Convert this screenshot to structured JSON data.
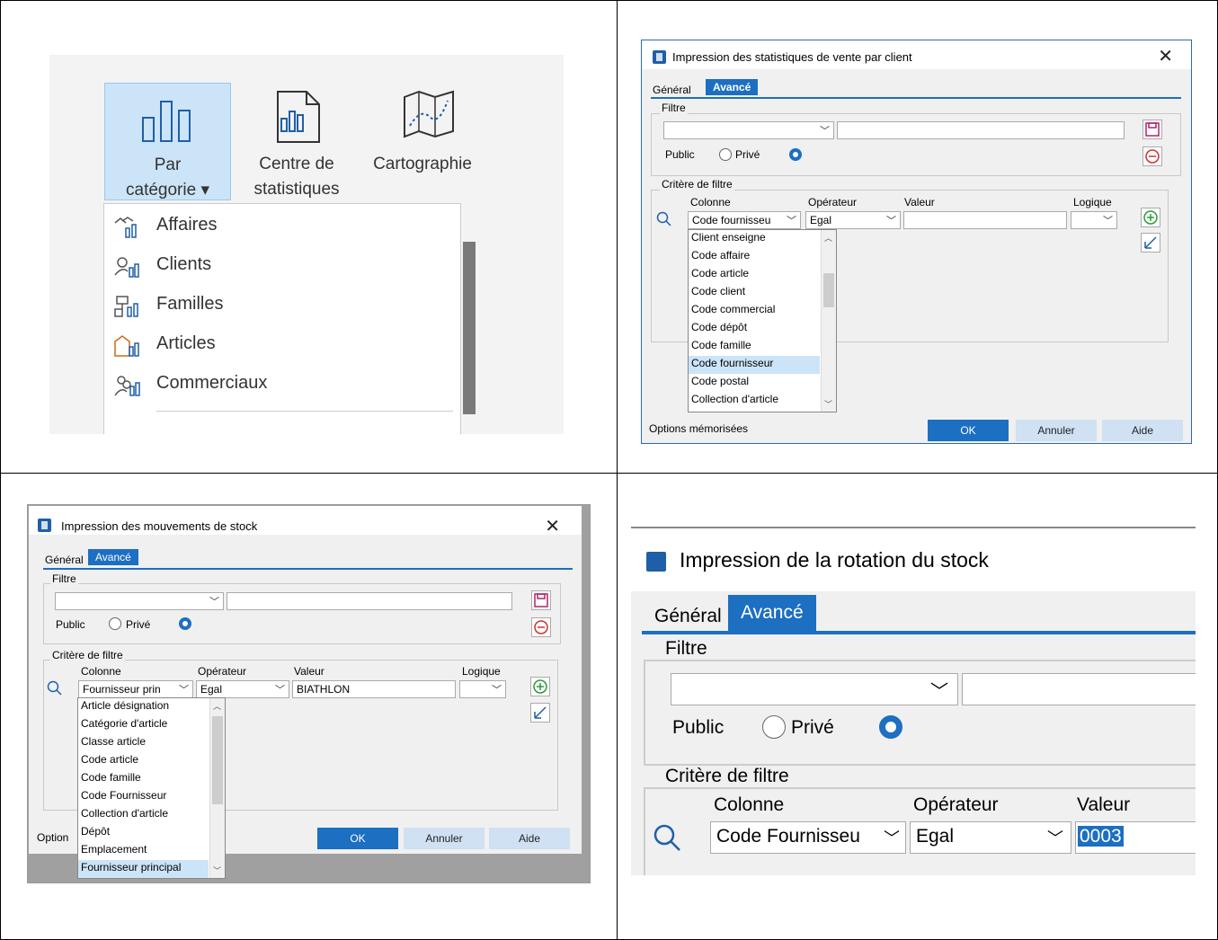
{
  "ribbon": {
    "buttons": [
      {
        "line1": "Par",
        "line2": "catégorie ▾"
      },
      {
        "line1": "Centre de",
        "line2": "statistiques"
      },
      {
        "line1": "Cartographie",
        "line2": ""
      }
    ],
    "menu_items": [
      "Affaires",
      "Clients",
      "Familles",
      "Articles",
      "Commerciaux"
    ]
  },
  "dialog1": {
    "title": "Impression des statistiques de vente par client",
    "tabs": [
      "Général",
      "Avancé"
    ],
    "filter_group": "Filtre",
    "public_label": "Public",
    "private_label": "Privé",
    "criteria_group": "Critère de filtre",
    "headers": {
      "col": "Colonne",
      "op": "Opérateur",
      "val": "Valeur",
      "logic": "Logique"
    },
    "column_value": "Code fournisseu",
    "operator_value": "Egal",
    "value_value": "",
    "dropdown": [
      "Client enseigne",
      "Code affaire",
      "Code article",
      "Code client",
      "Code commercial",
      "Code dépôt",
      "Code famille",
      "Code fournisseur",
      "Code postal",
      "Collection d'article"
    ],
    "selected_index": 7,
    "memorized": "Options mémorisées",
    "ok": "OK",
    "cancel": "Annuler",
    "help": "Aide"
  },
  "dialog2": {
    "title": "Impression des mouvements de stock",
    "tabs": [
      "Général",
      "Avancé"
    ],
    "filter_group": "Filtre",
    "public_label": "Public",
    "private_label": "Privé",
    "criteria_group": "Critère de filtre",
    "headers": {
      "col": "Colonne",
      "op": "Opérateur",
      "val": "Valeur",
      "logic": "Logique"
    },
    "column_value": "Fournisseur prin",
    "operator_value": "Egal",
    "value_value": "BIATHLON",
    "dropdown": [
      "Article désignation",
      "Catégorie d'article",
      "Classe article",
      "Code article",
      "Code famille",
      "Code Fournisseur",
      "Collection d'article",
      "Dépôt",
      "Emplacement",
      "Fournisseur principal"
    ],
    "selected_index": 9,
    "memorized": "Option",
    "ok": "OK",
    "cancel": "Annuler",
    "help": "Aide"
  },
  "dialog3": {
    "title": "Impression de la rotation du stock",
    "tabs": [
      "Général",
      "Avancé"
    ],
    "filter_group": "Filtre",
    "public_label": "Public",
    "private_label": "Privé",
    "criteria_group": "Critère de filtre",
    "headers": {
      "col": "Colonne",
      "op": "Opérateur",
      "val": "Valeur"
    },
    "column_value": "Code Fournisseu",
    "operator_value": "Egal",
    "value_value": "0003"
  },
  "colors": {
    "accent": "#1c6fc1",
    "selection": "#cce4f7",
    "button_secondary": "#cfe1f3"
  }
}
